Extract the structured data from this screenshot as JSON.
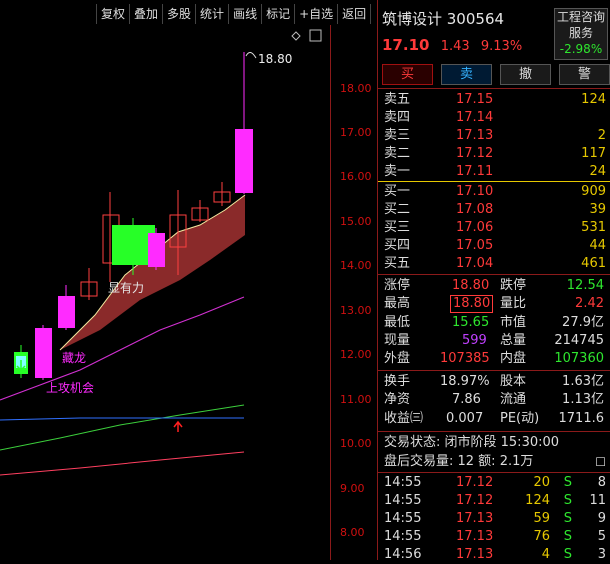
{
  "toolbar": [
    "复权",
    "叠加",
    "多股",
    "统计",
    "画线",
    "标记",
    "+自选",
    "返回"
  ],
  "chart": {
    "axis_ticks": [
      "18.00",
      "17.00",
      "16.00",
      "15.00",
      "14.00",
      "13.00",
      "12.00",
      "11.00",
      "10.00",
      "9.00",
      "8.00"
    ],
    "high_label": "18.80",
    "annotations": {
      "strong": "显有力",
      "rise": "上攻机会",
      "hidden": "藏龙"
    },
    "colors": {
      "up": "#ff2bff",
      "down": "#27ff27",
      "axis": "#d01010"
    }
  },
  "stock": {
    "name": "筑博设计 300564",
    "price": "17.10",
    "change": "1.43",
    "pct": "9.13%",
    "sector_line1": "工程咨询",
    "sector_line2": "服务",
    "sector_pct": "-2.98%"
  },
  "buttons": {
    "buy": "买",
    "sell": "卖",
    "cancel": "撤",
    "alert": "警"
  },
  "asks": [
    {
      "label": "卖五",
      "price": "17.15",
      "vol": "124"
    },
    {
      "label": "卖四",
      "price": "17.14",
      "vol": ""
    },
    {
      "label": "卖三",
      "price": "17.13",
      "vol": "2"
    },
    {
      "label": "卖二",
      "price": "17.12",
      "vol": "117"
    },
    {
      "label": "卖一",
      "price": "17.11",
      "vol": "24"
    }
  ],
  "bids": [
    {
      "label": "买一",
      "price": "17.10",
      "vol": "909"
    },
    {
      "label": "买二",
      "price": "17.08",
      "vol": "39"
    },
    {
      "label": "买三",
      "price": "17.06",
      "vol": "531"
    },
    {
      "label": "买四",
      "price": "17.05",
      "vol": "44"
    },
    {
      "label": "买五",
      "price": "17.04",
      "vol": "461"
    }
  ],
  "stats": {
    "zt_l": "涨停",
    "zt": "18.80",
    "dt_l": "跌停",
    "dt": "12.54",
    "zg_l": "最高",
    "zg": "18.80",
    "lb_l": "量比",
    "lb": "2.42",
    "zd_l": "最低",
    "zd": "15.65",
    "sz_l": "市值",
    "sz": "27.9亿",
    "xl_l": "现量",
    "xl": "599",
    "zl_l": "总量",
    "zl": "214745",
    "wp_l": "外盘",
    "wp": "107385",
    "np_l": "内盘",
    "np": "107360",
    "hs_l": "换手",
    "hs": "18.97%",
    "gb_l": "股本",
    "gb": "1.63亿",
    "jz_l": "净资",
    "jz": "7.86",
    "lt_l": "流通",
    "lt": "1.13亿",
    "sy_l": "收益㈢",
    "sy": "0.007",
    "pe_l": "PE(动)",
    "pe": "1711.6"
  },
  "status": {
    "state": "交易状态: 闭市阶段 15:30:00",
    "after": "盘后交易量: 12  额: 2.1万",
    "toggle": "☐"
  },
  "ticks": [
    {
      "time": "14:55",
      "price": "17.12",
      "vol": "20",
      "side": "S",
      "n": "8"
    },
    {
      "time": "14:55",
      "price": "17.12",
      "vol": "124",
      "side": "S",
      "n": "11"
    },
    {
      "time": "14:55",
      "price": "17.13",
      "vol": "59",
      "side": "S",
      "n": "9"
    },
    {
      "time": "14:55",
      "price": "17.13",
      "vol": "76",
      "side": "S",
      "n": "5"
    },
    {
      "time": "14:56",
      "price": "17.13",
      "vol": "4",
      "side": "S",
      "n": "3"
    }
  ]
}
